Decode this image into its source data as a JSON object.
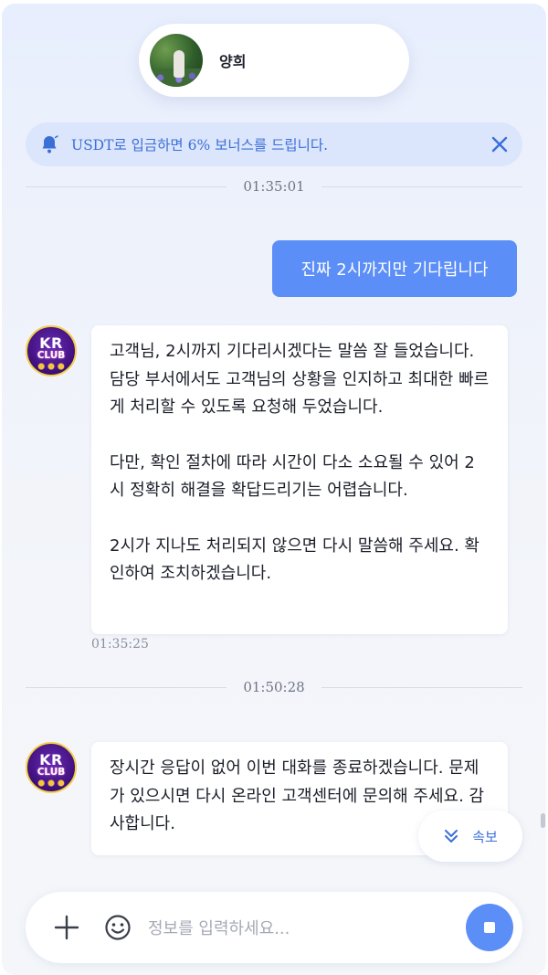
{
  "agent": {
    "name": "양희"
  },
  "notice": {
    "text": "USDT로 입금하면 6% 보너스를 드립니다."
  },
  "dividers": [
    "01:35:01",
    "01:50:28"
  ],
  "messages": {
    "user_1": "진짜 2시까지만 기다립니다",
    "bot_1": {
      "p1": "고객님, 2시까지 기다리시겠다는 말씀 잘 들었습니다. 담당 부서에서도 고객님의 상황을 인지하고 최대한 빠르게 처리할 수 있도록 요청해 두었습니다.",
      "p2": "다만, 확인 절차에 따라 시간이 다소 소요될 수 있어 2시 정확히 해결을 확답드리기는 어렵습니다.",
      "p3": "2시가 지나도 처리되지 않으면 다시 말씀해 주세요. 확인하여 조치하겠습니다.",
      "time": "01:35:25"
    },
    "bot_2": {
      "text": "장시간 응답이 없어 이번 대화를 종료하겠습니다. 문제가 있으시면 다시 온라인 고객센터에 문의해 주세요. 감사합니다."
    }
  },
  "bot_avatar": {
    "line1": "KR",
    "line2": "CLUB"
  },
  "quick_button": {
    "label": "속보"
  },
  "composer": {
    "placeholder": "정보를 입력하세요..."
  },
  "colors": {
    "accent": "#5b8ef7",
    "notice_text": "#3b6fd8",
    "notice_bg": "#dbe5fb"
  }
}
